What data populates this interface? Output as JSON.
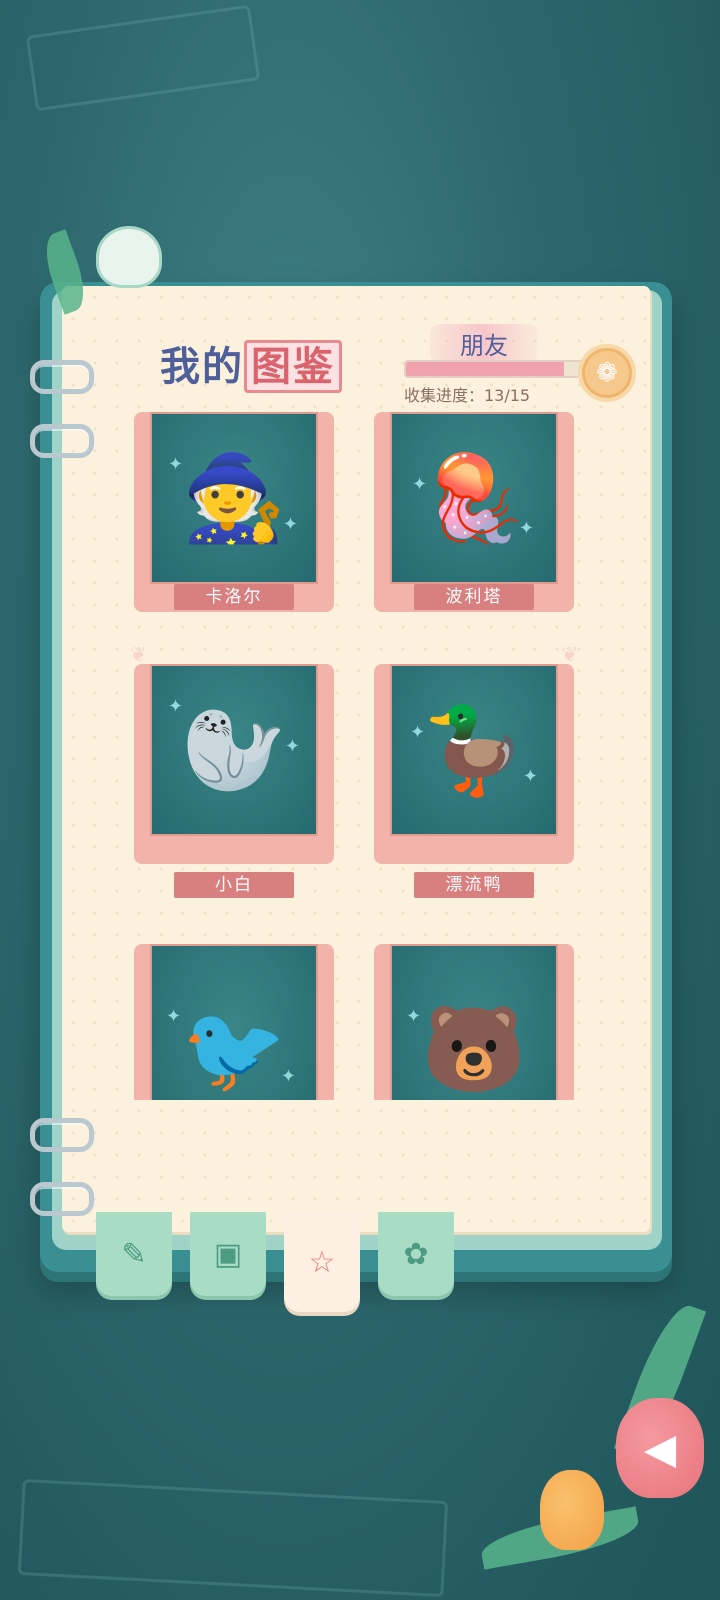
{
  "header": {
    "title_part1": "我的",
    "title_highlight": "图鉴",
    "category": "朋友",
    "progress_text": "收集进度：13/15",
    "progress_fraction": 0.867
  },
  "cards": [
    {
      "name": "卡洛尔",
      "icon": "witch-guitarist"
    },
    {
      "name": "波利塔",
      "icon": "jellyfish"
    },
    {
      "name": "小白",
      "icon": "seal-with-hat"
    },
    {
      "name": "漂流鸭",
      "icon": "duck-on-float"
    },
    {
      "name": "",
      "icon": "blue-bird"
    },
    {
      "name": "",
      "icon": "pink-bear"
    }
  ],
  "tabs": [
    {
      "id": "notes",
      "icon": "edit-note-icon"
    },
    {
      "id": "photos",
      "icon": "photo-album-icon"
    },
    {
      "id": "collection",
      "icon": "star-book-icon",
      "active": true
    },
    {
      "id": "flower",
      "icon": "flower-icon"
    }
  ],
  "colors": {
    "background": "#2c676d",
    "page": "#fbf1dd",
    "accent_pink": "#d87f80",
    "title_blue": "#4f5f99"
  }
}
